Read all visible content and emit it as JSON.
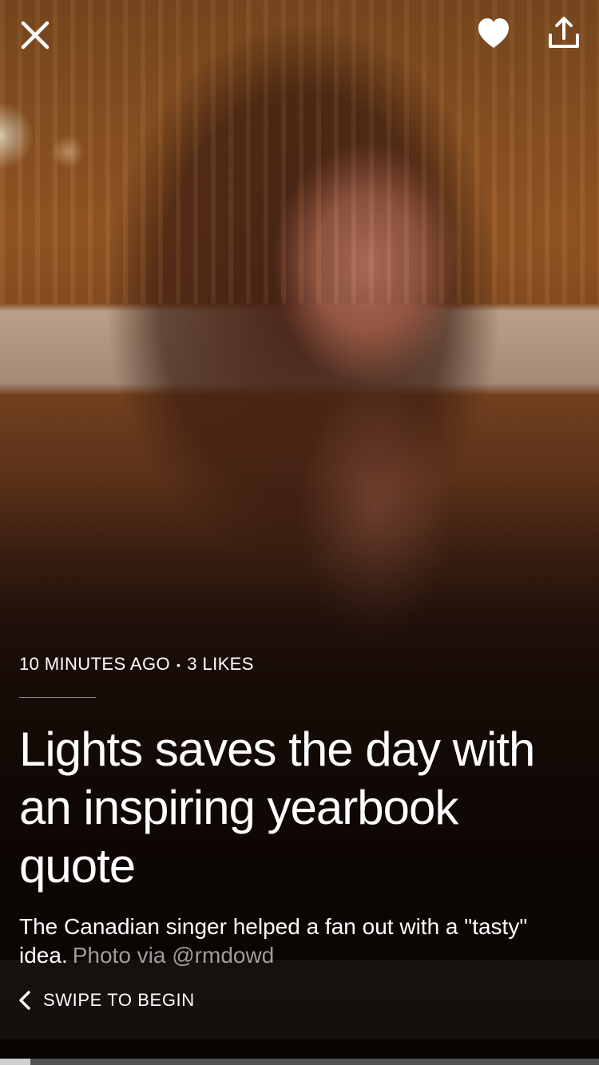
{
  "top_bar": {
    "close_icon": "close-icon",
    "like_icon": "heart-icon",
    "share_icon": "share-icon"
  },
  "story": {
    "time_ago": "10 MINUTES AGO",
    "separator": "•",
    "likes": "3 LIKES",
    "headline": "Lights saves the day with an inspiring yearbook quote",
    "dek": "The Canadian singer helped a fan out with a \"tasty\" idea.",
    "photo_credit": "Photo via @rmdowd"
  },
  "swipe": {
    "chevron_icon": "chevron-left-icon",
    "label": "SWIPE TO BEGIN"
  },
  "progress": {
    "fraction": 0.05
  },
  "colors": {
    "text": "#ffffff",
    "progress_fill": "#cfcfcf",
    "progress_track": "#5a5a5a"
  }
}
